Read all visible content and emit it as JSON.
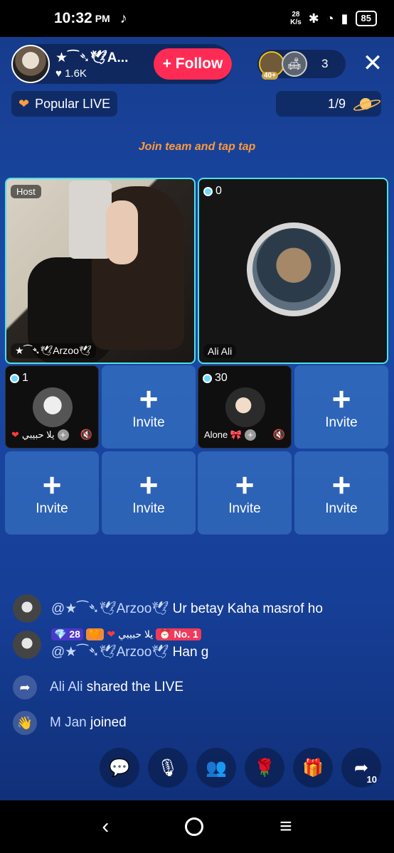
{
  "status": {
    "time": "10:32",
    "ampm": "PM",
    "net_speed": "28\nK/s",
    "battery": "85"
  },
  "host": {
    "name": "★⁀➴🕊A...",
    "likes": "♥ 1.6K",
    "follow_label": "+ Follow"
  },
  "viewers": {
    "badge": "40+",
    "count": "3"
  },
  "popular_label": "Popular LIVE",
  "rank": "1/9",
  "join_team": "Join team and tap tap",
  "grid": {
    "host_tag": "Host",
    "host_name": "★⁀➴🕊Arzoo🕊",
    "guest_score": "0",
    "guest_name": "Ali Ali",
    "slot1_score": "1",
    "slot1_name": "يلا حبيبي",
    "slot3_score": "30",
    "slot3_name": "Alone 🎀",
    "invite_label": "Invite"
  },
  "chat": [
    {
      "user": "@★⁀➴🕊Arzoo🕊",
      "text": "Ur betay Kaha masrof ho"
    },
    {
      "badge_level": "28",
      "badge_name": "يلا حبيبي",
      "rank_badge": "No. 1",
      "user": "@★⁀➴🕊Arzoo🕊",
      "text": "Han g"
    },
    {
      "user": "Ali Ali",
      "text": "shared the LIVE"
    },
    {
      "user": "M Jan",
      "text": "joined"
    }
  ],
  "actions": {
    "share_count": "10"
  },
  "colors": {
    "accent": "#fe2c55",
    "background": "#1a4aa8",
    "highlight": "#4fe0e8"
  }
}
